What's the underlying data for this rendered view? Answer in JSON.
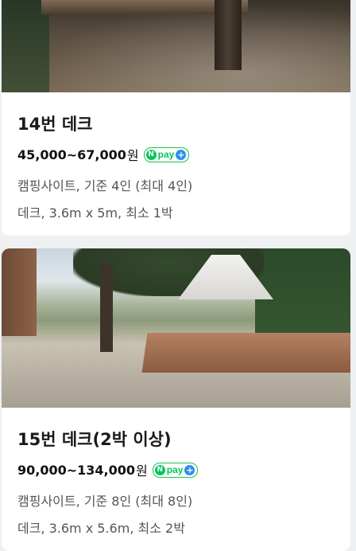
{
  "listings": [
    {
      "title": "14번 데크",
      "price": "45,000~67,000",
      "currency": "원",
      "pay_badge": {
        "n": "N",
        "label": "pay",
        "plus": "+"
      },
      "info_line1": "캠핑사이트, 기준 4인 (최대 4인)",
      "info_line2": "데크, 3.6m x 5m, 최소 1박"
    },
    {
      "title": "15번 데크(2박 이상)",
      "price": "90,000~134,000",
      "currency": "원",
      "pay_badge": {
        "n": "N",
        "label": "pay",
        "plus": "+"
      },
      "info_line1": "캠핑사이트, 기준 8인 (최대 8인)",
      "info_line2": "데크, 3.6m x 5.6m, 최소 2박"
    }
  ],
  "colors": {
    "npay_green": "#03c75a",
    "npay_plus_blue": "#2d8ff0",
    "page_bg": "#eef0f2"
  }
}
